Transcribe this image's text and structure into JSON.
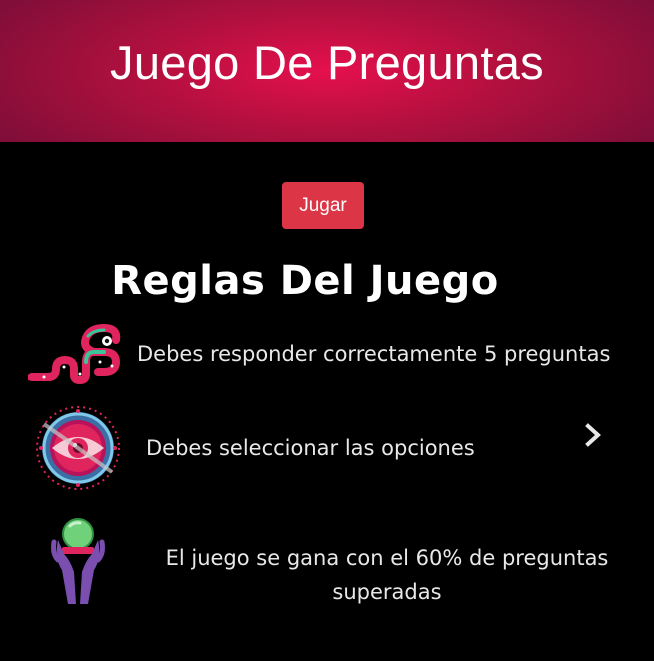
{
  "header": {
    "title": "Juego De Preguntas"
  },
  "actions": {
    "play_label": "Jugar"
  },
  "rules": {
    "title": "Reglas Del Juego",
    "items": [
      {
        "icon": "snake-icon",
        "text": "Debes responder correctamente 5 preguntas"
      },
      {
        "icon": "eye-mandala-icon",
        "text": "Debes seleccionar las opciones"
      },
      {
        "icon": "crystal-ball-hands-icon",
        "text": "El juego se gana con el 60% de preguntas superadas"
      }
    ]
  },
  "carousel": {
    "next_icon": "chevron-right-icon"
  },
  "colors": {
    "header_center": "#e5104e",
    "header_edge": "#7d0e38",
    "button": "#dc3545",
    "background": "#000000",
    "text": "#ffffff"
  }
}
